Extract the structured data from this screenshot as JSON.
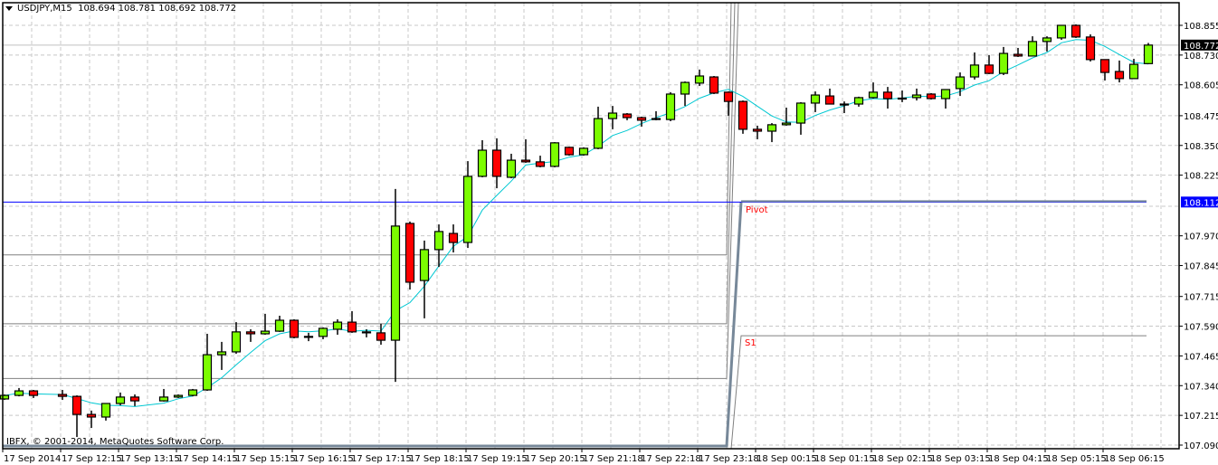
{
  "header": {
    "symbol": "USDJPY,M15",
    "ohlc": "108.694 108.781 108.692 108.772"
  },
  "copyright": "IBFX, © 2001-2014, MetaQuotes Software Corp.",
  "colors": {
    "bull": "#7cfc00",
    "bear": "#ff0000",
    "ma": "#00c8d2",
    "pivot_line": "#0000ff",
    "pivot_label": "#ff0000",
    "level": "#808080"
  },
  "chart_data": {
    "type": "candlestick",
    "symbol": "USDJPY",
    "timeframe": "M15",
    "ylim": [
      107.09,
      108.855
    ],
    "y_ticks": [
      "108.855",
      "108.730",
      "108.605",
      "108.475",
      "108.350",
      "108.225",
      "107.970",
      "107.845",
      "107.715",
      "107.590",
      "107.465",
      "107.340",
      "107.215",
      "107.090"
    ],
    "x_ticks": [
      "17 Sep 2014",
      "17 Sep 12:15",
      "17 Sep 13:15",
      "17 Sep 14:15",
      "17 Sep 15:15",
      "17 Sep 16:15",
      "17 Sep 17:15",
      "17 Sep 18:15",
      "17 Sep 19:15",
      "17 Sep 20:15",
      "17 Sep 21:18",
      "17 Sep 22:18",
      "17 Sep 23:18",
      "18 Sep 00:15",
      "18 Sep 01:15",
      "18 Sep 02:15",
      "18 Sep 03:15",
      "18 Sep 04:15",
      "18 Sep 05:15",
      "18 Sep 06:15"
    ],
    "current_price": "108.772",
    "pivot_price": "108.112",
    "pivot_label": "Pivot",
    "s1_label": "S1",
    "s1_price": 107.55,
    "prev_levels": [
      107.89,
      107.6,
      107.37,
      107.09
    ],
    "ma_period": 5,
    "candles": [
      [
        107.284,
        107.303,
        107.28,
        107.299
      ],
      [
        107.299,
        107.33,
        107.295,
        107.318
      ],
      [
        107.318,
        107.322,
        107.288,
        107.299
      ],
      null,
      [
        107.303,
        107.322,
        107.28,
        107.295
      ],
      [
        107.295,
        107.299,
        107.124,
        107.219
      ],
      [
        107.219,
        107.235,
        107.162,
        107.208
      ],
      [
        107.208,
        107.265,
        107.193,
        107.265
      ],
      [
        107.265,
        107.311,
        107.257,
        107.292
      ],
      [
        107.292,
        107.303,
        107.254,
        107.276
      ],
      null,
      [
        107.276,
        107.326,
        107.273,
        107.292
      ],
      [
        107.292,
        107.303,
        107.288,
        107.299
      ],
      [
        107.299,
        107.326,
        107.295,
        107.322
      ],
      [
        107.322,
        107.558,
        107.318,
        107.47
      ],
      [
        107.47,
        107.524,
        107.406,
        107.482
      ],
      [
        107.482,
        107.607,
        107.474,
        107.566
      ],
      [
        107.566,
        107.577,
        107.524,
        107.558
      ],
      [
        107.558,
        107.642,
        107.554,
        107.569
      ],
      [
        107.569,
        107.634,
        107.566,
        107.615
      ],
      [
        107.615,
        107.619,
        107.539,
        107.543
      ],
      [
        107.543,
        107.562,
        107.527,
        107.547
      ],
      [
        107.547,
        107.585,
        107.535,
        107.581
      ],
      [
        107.577,
        107.619,
        107.554,
        107.607
      ],
      [
        107.607,
        107.653,
        107.562,
        107.566
      ],
      [
        107.566,
        107.577,
        107.543,
        107.562
      ],
      [
        107.562,
        107.6,
        107.512,
        107.531
      ],
      [
        107.531,
        108.167,
        107.356,
        108.011
      ],
      [
        108.022,
        108.03,
        107.744,
        107.775
      ],
      [
        107.782,
        107.95,
        107.623,
        107.912
      ],
      [
        107.912,
        108.018,
        107.839,
        107.988
      ],
      [
        107.98,
        108.018,
        107.9,
        107.942
      ],
      [
        107.942,
        108.284,
        107.919,
        108.22
      ],
      [
        108.22,
        108.372,
        108.216,
        108.33
      ],
      [
        108.33,
        108.38,
        108.17,
        108.22
      ],
      [
        108.216,
        108.315,
        108.212,
        108.288
      ],
      [
        108.288,
        108.376,
        108.277,
        108.281
      ],
      [
        108.281,
        108.307,
        108.258,
        108.262
      ],
      [
        108.262,
        108.364,
        108.258,
        108.361
      ],
      [
        108.342,
        108.345,
        108.307,
        108.311
      ],
      [
        108.311,
        108.342,
        108.307,
        108.338
      ],
      [
        108.338,
        108.513,
        108.334,
        108.463
      ],
      [
        108.463,
        108.516,
        108.418,
        108.486
      ],
      [
        108.482,
        108.486,
        108.456,
        108.467
      ],
      [
        108.467,
        108.471,
        108.429,
        108.456
      ],
      [
        108.459,
        108.494,
        108.456,
        108.463
      ],
      [
        108.459,
        108.574,
        108.452,
        108.566
      ],
      [
        108.566,
        108.619,
        108.516,
        108.615
      ],
      [
        108.612,
        108.669,
        108.6,
        108.642
      ],
      [
        108.638,
        108.642,
        108.566,
        108.57
      ],
      [
        108.574,
        108.577,
        108.475,
        108.535
      ],
      [
        108.535,
        108.539,
        108.399,
        108.418
      ],
      [
        108.418,
        108.433,
        108.376,
        108.41
      ],
      [
        108.41,
        108.444,
        108.364,
        108.437
      ],
      [
        108.437,
        108.509,
        108.433,
        108.444
      ],
      [
        108.444,
        108.532,
        108.395,
        108.528
      ],
      [
        108.528,
        108.577,
        108.49,
        108.562
      ],
      [
        108.558,
        108.589,
        108.524,
        108.524
      ],
      [
        108.52,
        108.535,
        108.486,
        108.524
      ],
      [
        108.524,
        108.555,
        108.513,
        108.551
      ],
      [
        108.551,
        108.615,
        108.547,
        108.574
      ],
      [
        108.574,
        108.596,
        108.505,
        108.547
      ],
      [
        108.547,
        108.581,
        108.532,
        108.549
      ],
      [
        108.551,
        108.589,
        108.539,
        108.562
      ],
      [
        108.566,
        108.57,
        108.543,
        108.547
      ],
      [
        108.547,
        108.585,
        108.505,
        108.585
      ],
      [
        108.589,
        108.657,
        108.558,
        108.638
      ],
      [
        108.638,
        108.741,
        108.627,
        108.688
      ],
      [
        108.688,
        108.73,
        108.65,
        108.653
      ],
      [
        108.653,
        108.764,
        108.646,
        108.737
      ],
      [
        108.733,
        108.76,
        108.722,
        108.726
      ],
      [
        108.726,
        108.809,
        108.726,
        108.787
      ],
      [
        108.787,
        108.809,
        108.745,
        108.802
      ],
      [
        108.802,
        108.855,
        108.794,
        108.855
      ],
      [
        108.855,
        108.859,
        108.802,
        108.806
      ],
      [
        108.806,
        108.817,
        108.703,
        108.711
      ],
      [
        108.711,
        108.711,
        108.623,
        108.657
      ],
      [
        108.661,
        108.707,
        108.615,
        108.631
      ],
      [
        108.631,
        108.714,
        108.631,
        108.691
      ],
      [
        108.694,
        108.781,
        108.692,
        108.772
      ]
    ]
  }
}
